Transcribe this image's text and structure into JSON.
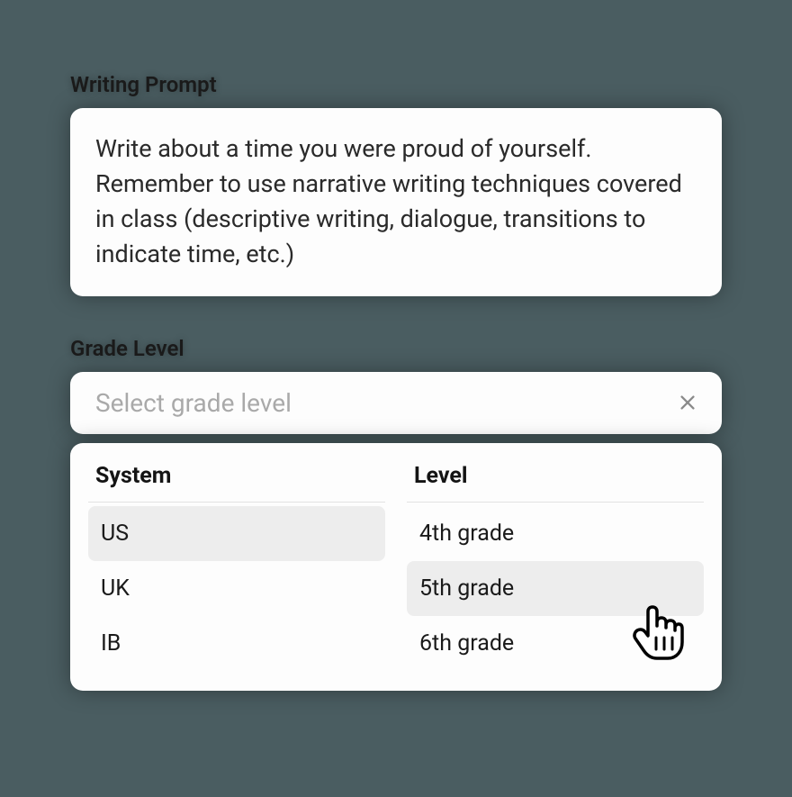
{
  "prompt_section": {
    "label": "Writing Prompt",
    "text": "Write about a time you were proud of yourself. Remember to use narrative writing techniques covered in class (descriptive writing, dialogue, transitions to indicate time, etc.)"
  },
  "grade_section": {
    "label": "Grade Level",
    "placeholder": "Select grade level",
    "columns": {
      "system": {
        "header": "System",
        "items": [
          "US",
          "UK",
          "IB"
        ],
        "selected": "US"
      },
      "level": {
        "header": "Level",
        "items": [
          "4th grade",
          "5th grade",
          "6th grade"
        ],
        "hovered": "5th grade"
      }
    }
  }
}
